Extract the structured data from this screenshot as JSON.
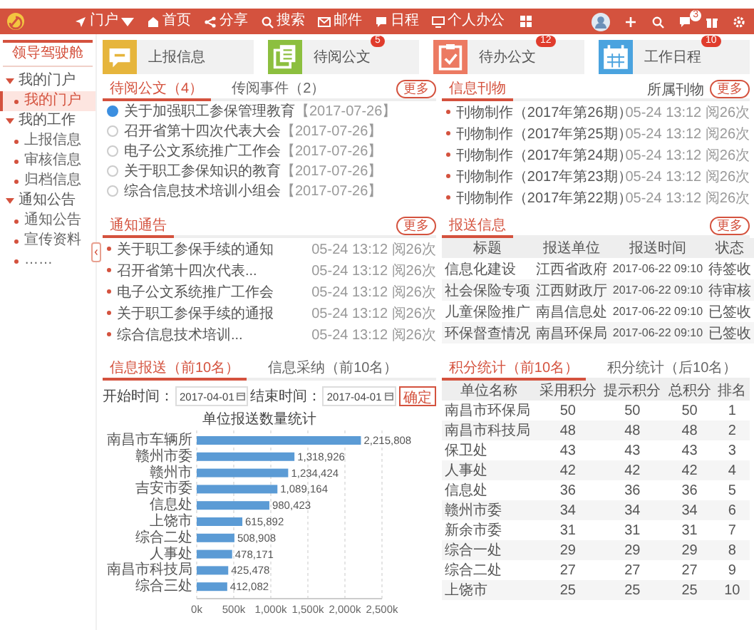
{
  "header": {
    "nav": [
      {
        "label": "门户",
        "kind": "dropdown"
      },
      {
        "label": "首页",
        "kind": "link"
      },
      {
        "label": "分享",
        "kind": "link"
      },
      {
        "label": "搜索",
        "kind": "link"
      },
      {
        "label": "邮件",
        "kind": "link"
      },
      {
        "label": "日程",
        "kind": "link"
      },
      {
        "label": "个人办公",
        "kind": "link"
      }
    ],
    "message_badge": "3"
  },
  "sidebar": {
    "title": "领导驾驶舱",
    "items": [
      {
        "label": "我的门户",
        "expanded": true,
        "children": [
          {
            "label": "我的门户",
            "selected": true
          }
        ]
      },
      {
        "label": "我的工作",
        "expanded": true,
        "children": [
          {
            "label": "上报信息",
            "selected": false
          },
          {
            "label": "审核信息",
            "selected": false
          },
          {
            "label": "归档信息",
            "selected": false
          }
        ]
      },
      {
        "label": "通知公告",
        "expanded": true,
        "children": [
          {
            "label": "通知公告",
            "selected": false
          },
          {
            "label": "宣传资料",
            "selected": false
          },
          {
            "label": "……",
            "selected": false
          }
        ]
      }
    ]
  },
  "cards": [
    {
      "label": "上报信息",
      "color": "#e6b53c"
    },
    {
      "label": "待阅公文",
      "color": "#8cbf3f",
      "badge": "5"
    },
    {
      "label": "待办公文",
      "color": "#ec7a62",
      "badge": "12"
    },
    {
      "label": "工作日程",
      "color": "#4aa3df",
      "badge": "10"
    }
  ],
  "todo_panel": {
    "tabs": [
      {
        "label": "待阅公文（4）",
        "selected": true
      },
      {
        "label": "传阅事件（2）",
        "selected": false
      }
    ],
    "more": "更多",
    "items": [
      {
        "title": "关于加强职工参保管理教育",
        "date": "【2017-07-26】",
        "selected": true
      },
      {
        "title": "召开省第十四次代表大会",
        "date": "【2017-07-26】",
        "selected": false
      },
      {
        "title": "电子公文系统推广工作会",
        "date": "【2017-07-26】",
        "selected": false
      },
      {
        "title": "关于职工参保知识的教育",
        "date": "【2017-07-26】",
        "selected": false
      },
      {
        "title": "综合信息技术培训小组会",
        "date": "【2017-07-26】",
        "selected": false
      }
    ]
  },
  "journal_panel": {
    "tabs": [
      {
        "label": "信息刊物",
        "selected": true
      }
    ],
    "filter": "所属刊物",
    "more": "更多",
    "items": [
      {
        "title": "刊物制作（2017年第26期）",
        "time": "05-24 13:12 阅26次"
      },
      {
        "title": "刊物制作（2017年第25期）",
        "time": "05-24 13:12 阅26次"
      },
      {
        "title": "刊物制作（2017年第24期）",
        "time": "05-24 13:12 阅26次"
      },
      {
        "title": "刊物制作（2017年第23期）",
        "time": "05-24 13:12 阅26次"
      },
      {
        "title": "刊物制作（2017年第22期）",
        "time": "05-24 13:12 阅26次"
      }
    ]
  },
  "notice_panel": {
    "tabs": [
      {
        "label": "通知通告",
        "selected": true
      }
    ],
    "more": "更多",
    "items": [
      {
        "title": "关于职工参保手续的通知",
        "time": "05-24 13:12 阅26次"
      },
      {
        "title": "召开省第十四次代表...",
        "time": "05-24 13:12 阅26次"
      },
      {
        "title": "电子公文系统推广工作会",
        "time": "05-24 13:12 阅26次"
      },
      {
        "title": "关于职工参保手续的通报",
        "time": "05-24 13:12 阅26次"
      },
      {
        "title": "综合信息技术培训...",
        "time": "05-24 13:12 阅26次"
      }
    ]
  },
  "report_panel": {
    "tabs": [
      {
        "label": "报送信息",
        "selected": true
      }
    ],
    "more": "更多",
    "columns": [
      "标题",
      "报送单位",
      "报送时间",
      "状态"
    ],
    "rows": [
      [
        "信息化建设",
        "江西省政府",
        "2017-06-22 09:10",
        "待签收"
      ],
      [
        "社会保险专项",
        "江西财政厅",
        "2017-06-22 09:10",
        "待审核"
      ],
      [
        "儿童保险推广",
        "南昌信息处",
        "2017-06-22 09:10",
        "已签收"
      ],
      [
        "环保督查情况",
        "南昌环保局",
        "2017-06-22 09:10",
        "已签收"
      ]
    ]
  },
  "stats_panel": {
    "tabs": [
      {
        "label": "信息报送（前10名）",
        "selected": true
      },
      {
        "label": "信息采纳（前10名）",
        "selected": false
      }
    ],
    "start_label": "开始时间：",
    "start_date": "2017-04-01",
    "end_label": "结束时间：",
    "end_date": "2017-04-01",
    "confirm": "确定",
    "chart_data": {
      "type": "bar",
      "orientation": "horizontal",
      "title": "单位报送数量统计",
      "categories": [
        "南昌市车辆所",
        "赣州市委",
        "赣州市",
        "吉安市委",
        "信息处",
        "上饶市",
        "综合二处",
        "人事处",
        "南昌市科技局",
        "综合三处"
      ],
      "values": [
        2215808,
        1318926,
        1234424,
        1089164,
        980423,
        615892,
        508908,
        478171,
        425478,
        412082
      ],
      "value_labels": [
        "2,215,808",
        "1,318,926",
        "1,234,424",
        "1,089,164",
        "980,423",
        "615,892",
        "508,908",
        "478,171",
        "425,478",
        "412,082"
      ],
      "grid": true,
      "xlim": [
        0,
        2500000
      ],
      "xticks": [
        {
          "value": 0,
          "label": "0k"
        },
        {
          "value": 500000,
          "label": "500k"
        },
        {
          "value": 1000000,
          "label": "1,000k"
        },
        {
          "value": 1500000,
          "label": "1,500k"
        },
        {
          "value": 2000000,
          "label": "2,000k"
        },
        {
          "value": 2500000,
          "label": "2,500k"
        }
      ]
    }
  },
  "ranking_panel": {
    "tabs": [
      {
        "label": "积分统计（前10名）",
        "selected": true
      },
      {
        "label": "积分统计（后10名）",
        "selected": false
      }
    ],
    "columns": [
      "单位名称",
      "采用积分",
      "提示积分",
      "总积分",
      "排名"
    ],
    "rows": [
      [
        "南昌市环保局",
        "50",
        "50",
        "50",
        "1"
      ],
      [
        "南昌市科技局",
        "48",
        "48",
        "48",
        "2"
      ],
      [
        "保卫处",
        "43",
        "43",
        "43",
        "3"
      ],
      [
        "人事处",
        "42",
        "42",
        "42",
        "4"
      ],
      [
        "信息处",
        "36",
        "36",
        "36",
        "5"
      ],
      [
        "赣州市委",
        "34",
        "34",
        "34",
        "6"
      ],
      [
        "新余市委",
        "31",
        "31",
        "31",
        "7"
      ],
      [
        "综合一处",
        "29",
        "29",
        "29",
        "8"
      ],
      [
        "综合二处",
        "27",
        "27",
        "27",
        "9"
      ],
      [
        "上饶市",
        "25",
        "25",
        "25",
        "10"
      ]
    ]
  }
}
